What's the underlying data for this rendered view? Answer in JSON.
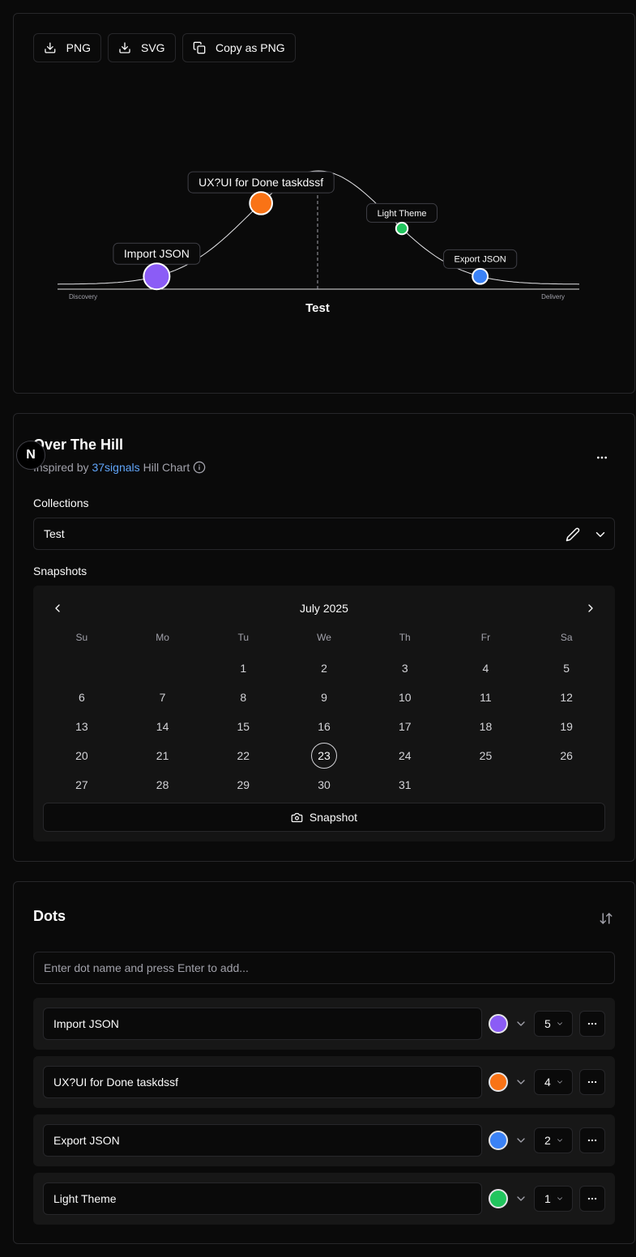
{
  "export": {
    "png_label": "PNG",
    "svg_label": "SVG",
    "copy_label": "Copy as PNG"
  },
  "chart": {
    "title": "Test",
    "left_label": "Discovery",
    "right_label": "Delivery",
    "dots": [
      {
        "name": "Import JSON",
        "color": "#8b5cf6",
        "size": 5,
        "progress": 0.19
      },
      {
        "name": "UX?UI for Done taskdssf",
        "color": "#f97316",
        "size": 4,
        "progress": 0.39
      },
      {
        "name": "Light Theme",
        "color": "#22c55e",
        "size": 1,
        "progress": 0.66
      },
      {
        "name": "Export JSON",
        "color": "#3b82f6",
        "size": 2,
        "progress": 0.81
      }
    ]
  },
  "hill": {
    "title": "Over The Hill",
    "subtitle_prefix": "Inspired by",
    "subtitle_link": "37signals",
    "subtitle_suffix": "Hill Chart",
    "collections_label": "Collections",
    "collection_value": "Test",
    "snapshots_label": "Snapshots",
    "calendar": {
      "month": "July 2025",
      "weekdays": [
        "Su",
        "Mo",
        "Tu",
        "We",
        "Th",
        "Fr",
        "Sa"
      ],
      "weeks": [
        [
          "",
          "",
          "1",
          "2",
          "3",
          "4",
          "5"
        ],
        [
          "6",
          "7",
          "8",
          "9",
          "10",
          "11",
          "12"
        ],
        [
          "13",
          "14",
          "15",
          "16",
          "17",
          "18",
          "19"
        ],
        [
          "20",
          "21",
          "22",
          "23",
          "24",
          "25",
          "26"
        ],
        [
          "27",
          "28",
          "29",
          "30",
          "31",
          "",
          ""
        ]
      ],
      "selected_day": "23"
    },
    "snapshot_label": "Snapshot"
  },
  "dots_panel": {
    "title": "Dots",
    "input_placeholder": "Enter dot name and press Enter to add...",
    "items": [
      {
        "name": "Import JSON",
        "color": "#8b5cf6",
        "size": "5"
      },
      {
        "name": "UX?UI for Done taskdssf",
        "color": "#f97316",
        "size": "4"
      },
      {
        "name": "Export JSON",
        "color": "#3b82f6",
        "size": "2"
      },
      {
        "name": "Light Theme",
        "color": "#22c55e",
        "size": "1"
      }
    ]
  }
}
